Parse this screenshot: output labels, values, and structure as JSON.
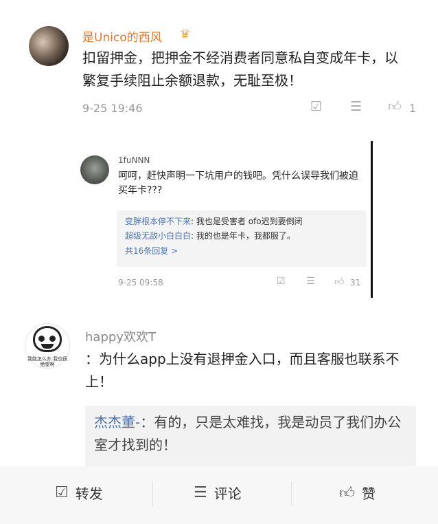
{
  "comment1": {
    "user": "是Unico的西风",
    "badge_icon": "crown-icon",
    "text": "扣留押金，把押金不经消费者同意私自变成年卡，以繁复手续阻止余额退款，无耻至极！",
    "time": "9-25 19:46",
    "like_count": "1"
  },
  "comment2": {
    "user": "1fuNNN",
    "text": "呵呵，赶快声明一下坑用户的钱吧。凭什么误导我们被迫买年卡???",
    "replies": [
      {
        "name": "变胖根本停不下来",
        "text": ": 我也是受害者 ofo迟到要倒闭"
      },
      {
        "name": "超级无敌小白白白",
        "text": ": 我的也是年卡，我都服了。"
      }
    ],
    "more_replies": "共16条回复 >",
    "time": "9-25 09:58",
    "like_count": "31"
  },
  "comment3": {
    "user": "happy欢欢T",
    "sticker_caption": "我能怎么办 我也很绝望啊",
    "text": "：为什么app上没有退押金入口，而且客服也联系不上！",
    "reply_name": "杰杰董-",
    "reply_text": "：有的，只是太难找，我是动员了我们办公室才找到的！"
  },
  "action_bar": {
    "share_label": "转发",
    "comment_label": "评论",
    "like_label": "赞"
  },
  "colors": {
    "username_orange": "#e0782e",
    "reply_name_blue": "#4a72b0",
    "meta_gray": "#9a9a9a"
  }
}
